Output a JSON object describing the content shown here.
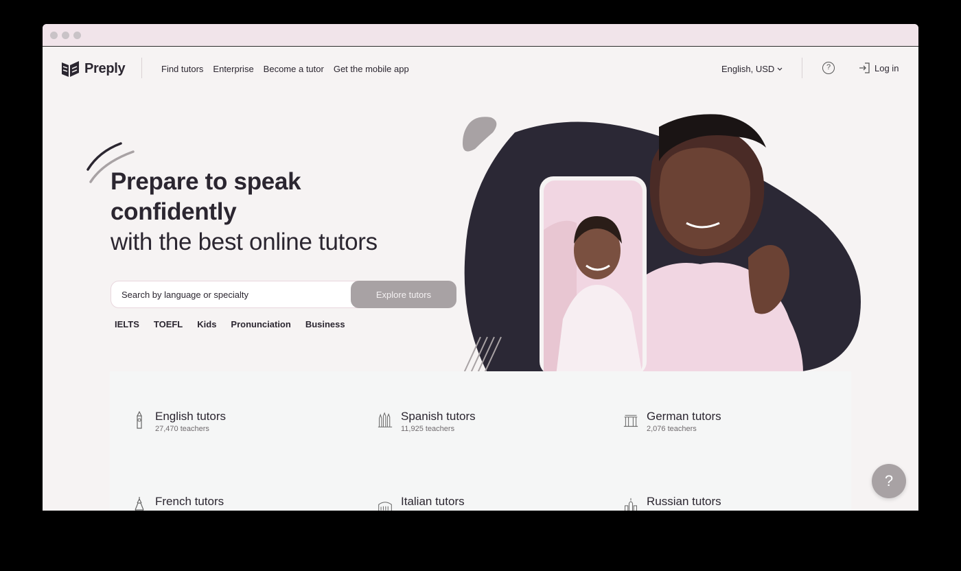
{
  "brand": {
    "name": "Preply"
  },
  "nav": {
    "links": [
      "Find tutors",
      "Enterprise",
      "Become a tutor",
      "Get the mobile app"
    ],
    "language": "English, USD",
    "login": "Log in"
  },
  "hero": {
    "title_bold_line1": "Prepare to speak",
    "title_bold_line2": "confidently",
    "title_light": "with the best online tutors",
    "search_placeholder": "Search by language or specialty",
    "search_button": "Explore tutors",
    "chips": [
      "IELTS",
      "TOEFL",
      "Kids",
      "Pronunciation",
      "Business"
    ]
  },
  "categories": [
    {
      "title": "English tutors",
      "count": "27,470 teachers",
      "icon": "big-ben-icon"
    },
    {
      "title": "Spanish tutors",
      "count": "11,925 teachers",
      "icon": "sagrada-familia-icon"
    },
    {
      "title": "German tutors",
      "count": "2,076 teachers",
      "icon": "brandenburg-gate-icon"
    },
    {
      "title": "French tutors",
      "count": "",
      "icon": "eiffel-tower-icon"
    },
    {
      "title": "Italian tutors",
      "count": "",
      "icon": "colosseum-icon"
    },
    {
      "title": "Russian tutors",
      "count": "",
      "icon": "kremlin-icon"
    }
  ],
  "help_button": "?",
  "colors": {
    "accent_button": "#a8a2a4",
    "dark_blob": "#2b2835",
    "pink": "#f2d4e0"
  }
}
